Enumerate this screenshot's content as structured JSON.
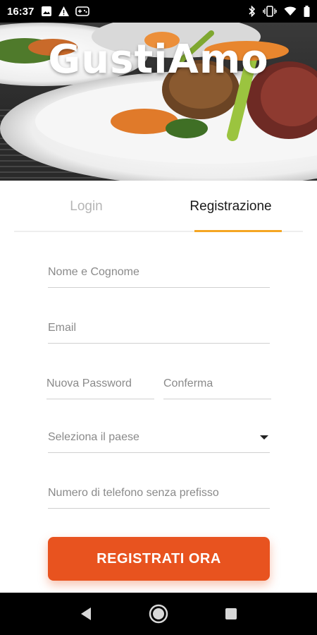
{
  "status_bar": {
    "time": "16:37",
    "left_icons": [
      "image-icon",
      "warning-icon",
      "game-controller-icon"
    ],
    "right_icons": [
      "bluetooth-icon",
      "vibrate-icon",
      "wifi-icon",
      "battery-icon"
    ]
  },
  "header": {
    "logo_text": "GustiAmo"
  },
  "tabs": [
    {
      "label": "Login",
      "active": false
    },
    {
      "label": "Registrazione",
      "active": true
    }
  ],
  "form": {
    "full_name": {
      "placeholder": "Nome e Cognome",
      "value": ""
    },
    "email": {
      "placeholder": "Email",
      "value": ""
    },
    "new_password": {
      "placeholder": "Nuova Password",
      "value": ""
    },
    "confirm_password": {
      "placeholder": "Conferma",
      "value": ""
    },
    "country": {
      "label": "Seleziona il paese"
    },
    "phone": {
      "placeholder": "Numero di telefono senza prefisso",
      "value": ""
    },
    "submit_label": "REGISTRATI ORA"
  },
  "nav_bar": {
    "icons": [
      "back-icon",
      "home-icon",
      "recents-icon"
    ]
  },
  "colors": {
    "accent": "#e8531f",
    "tab_indicator": "#f5a623",
    "status_bar_bg": "#000000",
    "nav_bar_bg": "#000000"
  }
}
